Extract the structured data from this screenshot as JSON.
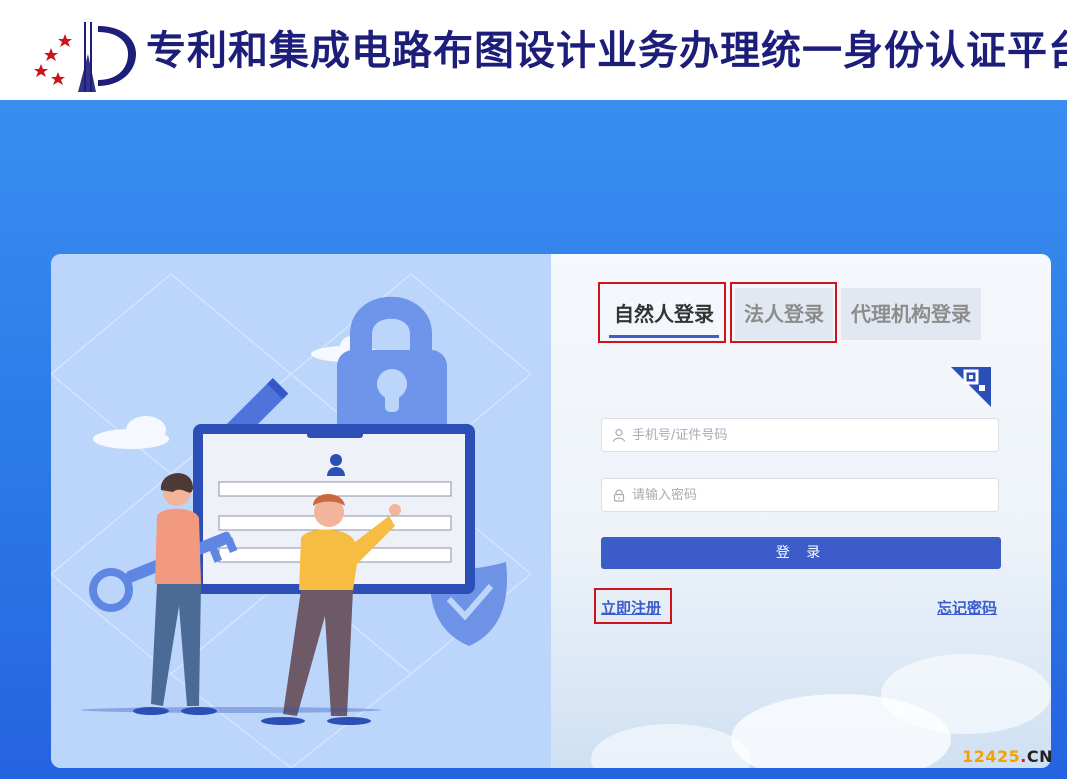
{
  "header": {
    "title": "专利和集成电路布图设计业务办理统一身份认证平台",
    "logo_name": "cnipa-logo"
  },
  "login": {
    "tabs": [
      {
        "label": "自然人登录",
        "active": true
      },
      {
        "label": "法人登录",
        "active": false
      },
      {
        "label": "代理机构登录",
        "active": false
      }
    ],
    "username_placeholder": "手机号/证件号码",
    "password_placeholder": "请输入密码",
    "submit_label": "登 录",
    "register_link": "立即注册",
    "forgot_link": "忘记密码"
  },
  "watermark": {
    "num": "12425",
    "dot": ".",
    "cn": "CN"
  },
  "colors": {
    "brand_navy": "#1d1d7a",
    "accent_blue": "#3b5cc9",
    "background_blue": "#2d7de9",
    "highlight_red": "#d0121b"
  }
}
